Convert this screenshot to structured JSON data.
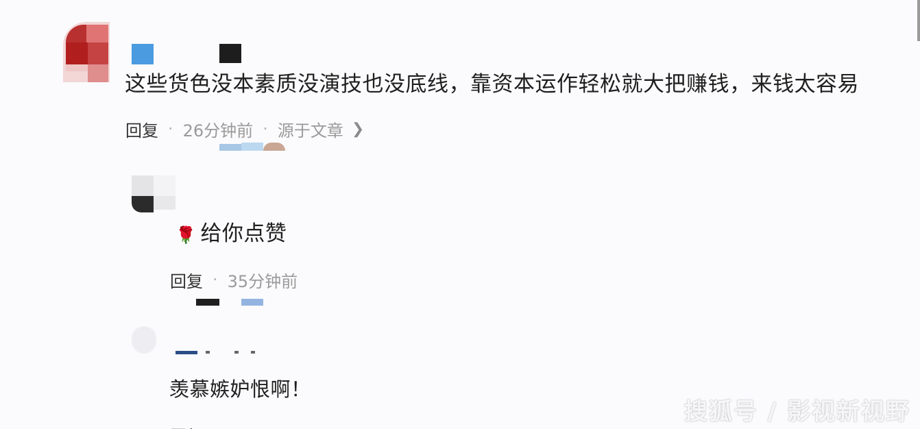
{
  "comments": [
    {
      "text": "这些货色没本素质没演技也没底线，靠资本运作轻松就大把赚钱，来钱太容易",
      "reply_label": "回复",
      "time": "26分钟前",
      "source": "源于文章"
    },
    {
      "text": "给你点赞",
      "emoji": "🌹",
      "reply_label": "回复",
      "time": "35分钟前"
    },
    {
      "text": "羡慕嫉妒恨啊！",
      "reply_label": "回复"
    }
  ],
  "watermark": "搜狐号 / 影视新视野",
  "icons": {
    "chevron": "chevron-right-icon",
    "rose": "rose-emoji-icon"
  }
}
